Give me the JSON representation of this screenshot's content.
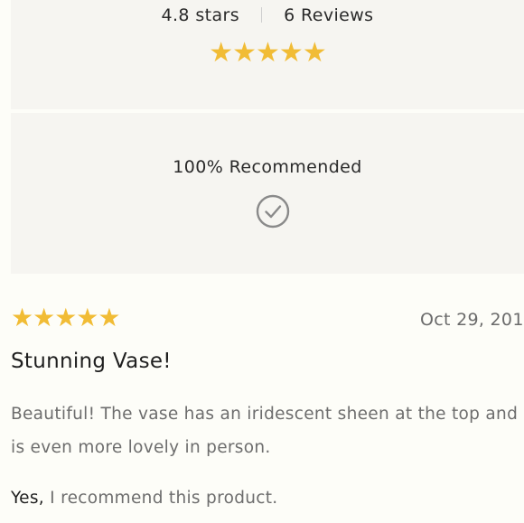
{
  "summary": {
    "average_label": "4.8 stars",
    "review_count_label": "6 Reviews",
    "stars": "★★★★★",
    "average_rating": 4.8,
    "recommend_label": "100% Recommended",
    "check_icon": "check-circle-icon"
  },
  "review": {
    "stars": "★★★★★",
    "rating": 5,
    "date": "Oct 29, 201",
    "title": "Stunning Vase!",
    "body_line_1": "Beautiful! The vase has an iridescent sheen at the top and",
    "body_line_2": "is even more lovely in person.",
    "recommend_yes": "Yes,",
    "recommend_text": " I recommend this product."
  },
  "colors": {
    "star": "#f1bc35",
    "panel_background": "#f6f5f1",
    "page_background": "#fdfdf8",
    "check_icon": "#8a8a8a"
  }
}
